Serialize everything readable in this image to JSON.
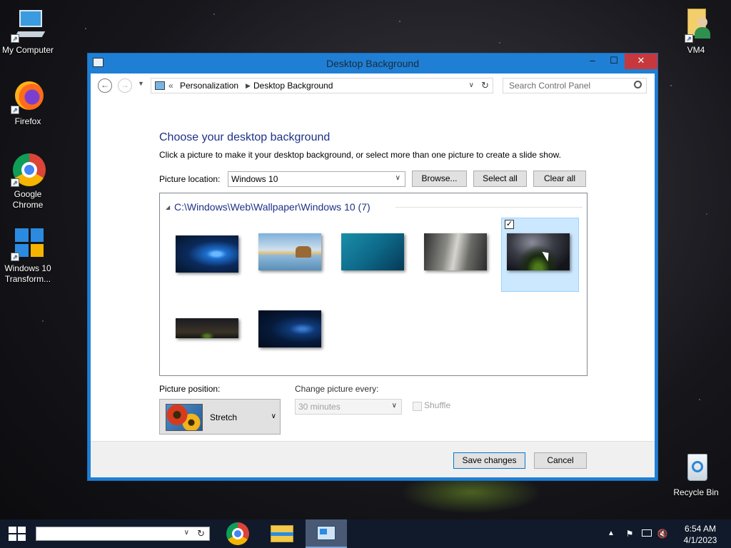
{
  "desktop": {
    "icons": [
      {
        "label": "My Computer"
      },
      {
        "label": "Firefox"
      },
      {
        "label": "Google Chrome"
      },
      {
        "label": "Windows 10 Transform..."
      },
      {
        "label": "VM4"
      },
      {
        "label": "Recycle Bin"
      }
    ]
  },
  "window": {
    "title": "Desktop Background",
    "controls": {
      "minimize": "–",
      "maximize": "☐",
      "close": "✕"
    },
    "address": {
      "prefix": "«",
      "crumbs": [
        "Personalization",
        "Desktop Background"
      ],
      "search_placeholder": "Search Control Panel"
    },
    "heading": "Choose your desktop background",
    "description": "Click a picture to make it your desktop background, or select more than one picture to create a slide show.",
    "picture_location": {
      "label": "Picture location:",
      "value": "Windows 10",
      "browse": "Browse...",
      "select_all": "Select all",
      "clear_all": "Clear all"
    },
    "gallery": {
      "group_header": "C:\\Windows\\Web\\Wallpaper\\Windows 10 (7)",
      "items": [
        {
          "name": "windows-light",
          "selected": false
        },
        {
          "name": "beach-rocks",
          "selected": false
        },
        {
          "name": "underwater-swimmer",
          "selected": false
        },
        {
          "name": "rock-cliff",
          "selected": false
        },
        {
          "name": "milky-way-tent",
          "selected": true
        },
        {
          "name": "milky-way-wide",
          "selected": false
        },
        {
          "name": "windows-dark",
          "selected": false
        }
      ]
    },
    "picture_position": {
      "label": "Picture position:",
      "value": "Stretch"
    },
    "change_every": {
      "label": "Change picture every:",
      "value": "30 minutes",
      "enabled": false
    },
    "shuffle": {
      "label": "Shuffle",
      "checked": false,
      "enabled": false
    },
    "footer": {
      "save": "Save changes",
      "cancel": "Cancel"
    }
  },
  "taskbar": {
    "time": "6:54 AM",
    "date": "4/1/2023"
  },
  "colors": {
    "window_border": "#1f7fd4",
    "heading": "#1e3287",
    "close": "#c7383c",
    "selection": "#cce8ff",
    "taskbar": "#101a2b"
  }
}
